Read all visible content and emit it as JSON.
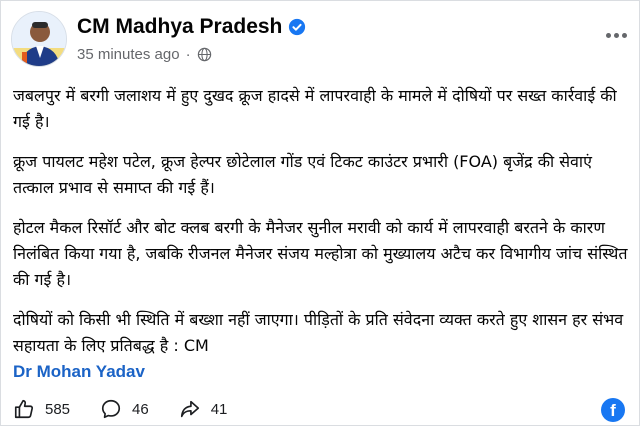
{
  "header": {
    "page_name": "CM Madhya Pradesh",
    "timestamp": "35 minutes ago",
    "separator": "·",
    "verified_color": "#1877f2"
  },
  "post": {
    "paragraphs": [
      "जबलपुर में बरगी जलाशय में हुए दुखद क्रूज हादसे में लापरवाही के मामले में दोषियों पर सख्त कार्रवाई की गई है।",
      "क्रूज पायलट महेश पटेल, क्रूज हेल्पर छोटेलाल गोंड एवं टिकट काउंटर प्रभारी (FOA) बृजेंद्र की सेवाएं तत्काल प्रभाव से समाप्त की गई हैं।",
      "होटल मैकल रिसॉर्ट और बोट क्लब बरगी के मैनेजर सुनील मरावी को कार्य में लापरवाही बरतने के कारण निलंबित किया गया है, जबकि रीजनल मैनेजर संजय मल्होत्रा को मुख्यालय अटैच कर विभागीय जांच संस्थित की गई है।",
      "दोषियों को किसी भी स्थिति में बख्शा नहीं जाएगा। पीड़ितों के प्रति संवेदना व्यक्त करते हुए शासन हर संभव सहायता के लिए प्रतिबद्ध है : CM"
    ],
    "tagged_person": "Dr Mohan Yadav",
    "tag_color": "#1b63c6"
  },
  "actions": {
    "likes": "585",
    "comments": "46",
    "shares": "41"
  },
  "icons": {
    "avatar": "profile-photo",
    "verified": "verified-badge-icon",
    "privacy": "globe-icon",
    "more": "more-options-icon",
    "like": "thumbs-up-icon",
    "comment": "comment-bubble-icon",
    "share": "share-arrow-icon",
    "platform": "facebook-icon"
  },
  "colors": {
    "brand": "#1877f2",
    "muted": "#65676b"
  }
}
